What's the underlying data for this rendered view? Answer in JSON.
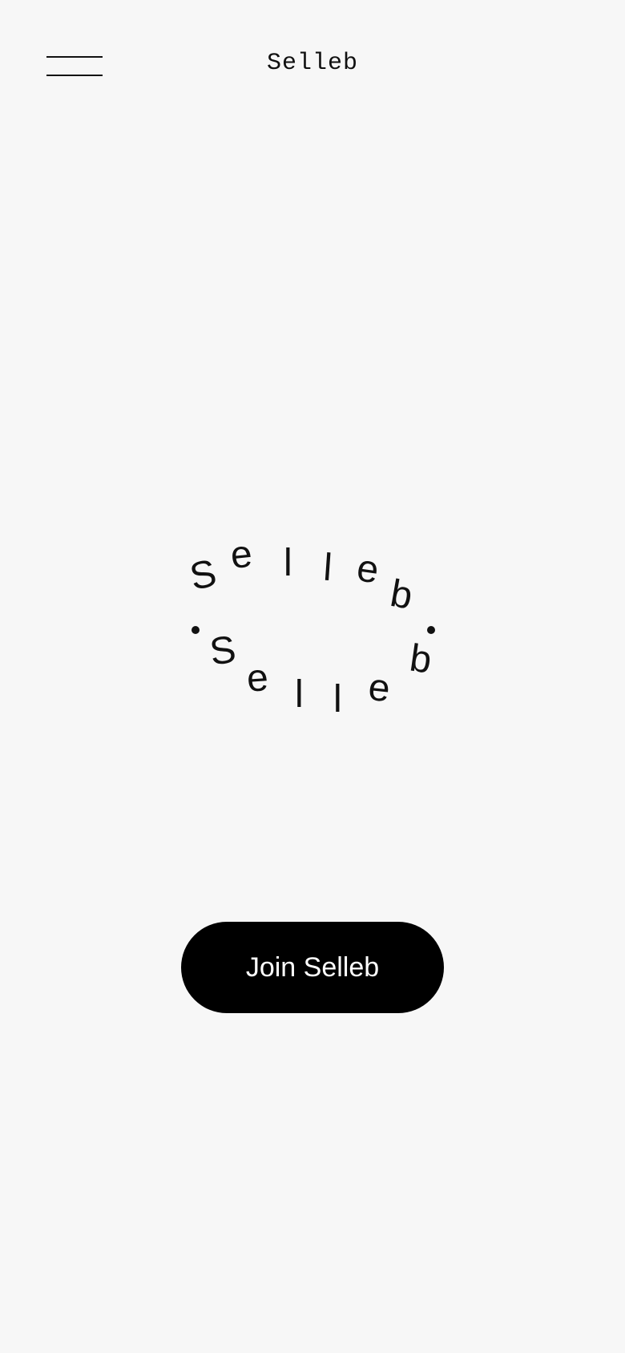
{
  "header": {
    "menu_icon": "hamburger-menu-icon",
    "title": "Selleb"
  },
  "logo": {
    "top_letters": [
      "S",
      "e",
      "l",
      "l",
      "e",
      "b"
    ],
    "bottom_letters": [
      "S",
      "e",
      "l",
      "l",
      "e",
      "b"
    ]
  },
  "cta": {
    "join_label": "Join Selleb"
  },
  "colors": {
    "background": "#f7f7f7",
    "text": "#111111",
    "button_bg": "#000000",
    "button_text": "#ffffff"
  }
}
